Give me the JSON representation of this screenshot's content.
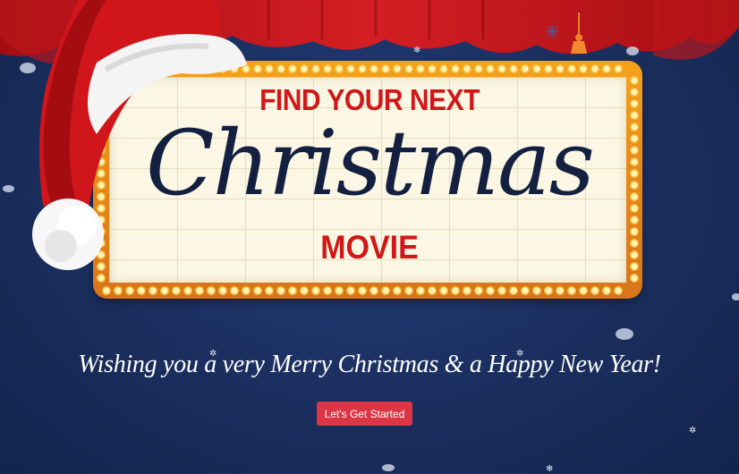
{
  "hero": {
    "title_top": "FIND YOUR NEXT",
    "title_script": "Christmas",
    "title_bottom": "MOVIE"
  },
  "greeting": "Wishing you a very Merry Christmas & a Happy New Year!",
  "cta": {
    "label": "Let's Get Started"
  },
  "colors": {
    "background": "#1c3163",
    "curtain": "#c4141b",
    "marquee_frame": "#f0a020",
    "title_red": "#d01818",
    "script_navy": "#142040",
    "cta_red": "#dc3545"
  },
  "icons": [
    "santa-hat-icon",
    "curtain-icon",
    "snowflake-icon",
    "tassel-icon",
    "bulb-icon"
  ]
}
